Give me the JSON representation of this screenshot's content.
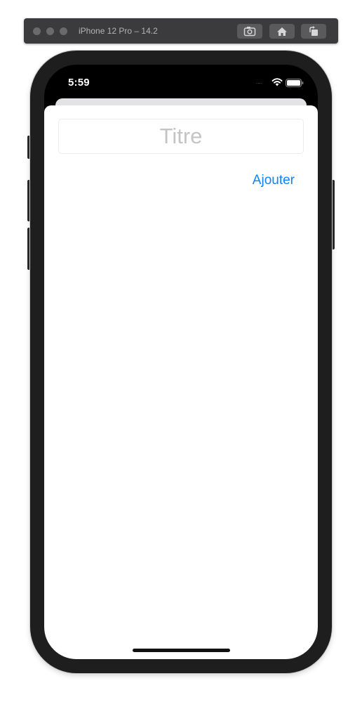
{
  "simulator": {
    "title": "iPhone 12 Pro – 14.2",
    "buttons": [
      {
        "icon": "screenshot-icon",
        "name": "screenshot"
      },
      {
        "icon": "home-icon",
        "name": "home"
      },
      {
        "icon": "rotate-icon",
        "name": "rotate"
      }
    ]
  },
  "status_bar": {
    "time": "5:59",
    "signal": "....",
    "icons": [
      "wifi-icon",
      "battery-icon"
    ]
  },
  "form": {
    "title_placeholder": "Titre",
    "title_value": "",
    "add_label": "Ajouter"
  },
  "colors": {
    "accent": "#0A84FF",
    "placeholder": "#C4C4C6",
    "device_frame": "#1E1E1E",
    "toolbar": "#3B3B3D"
  }
}
